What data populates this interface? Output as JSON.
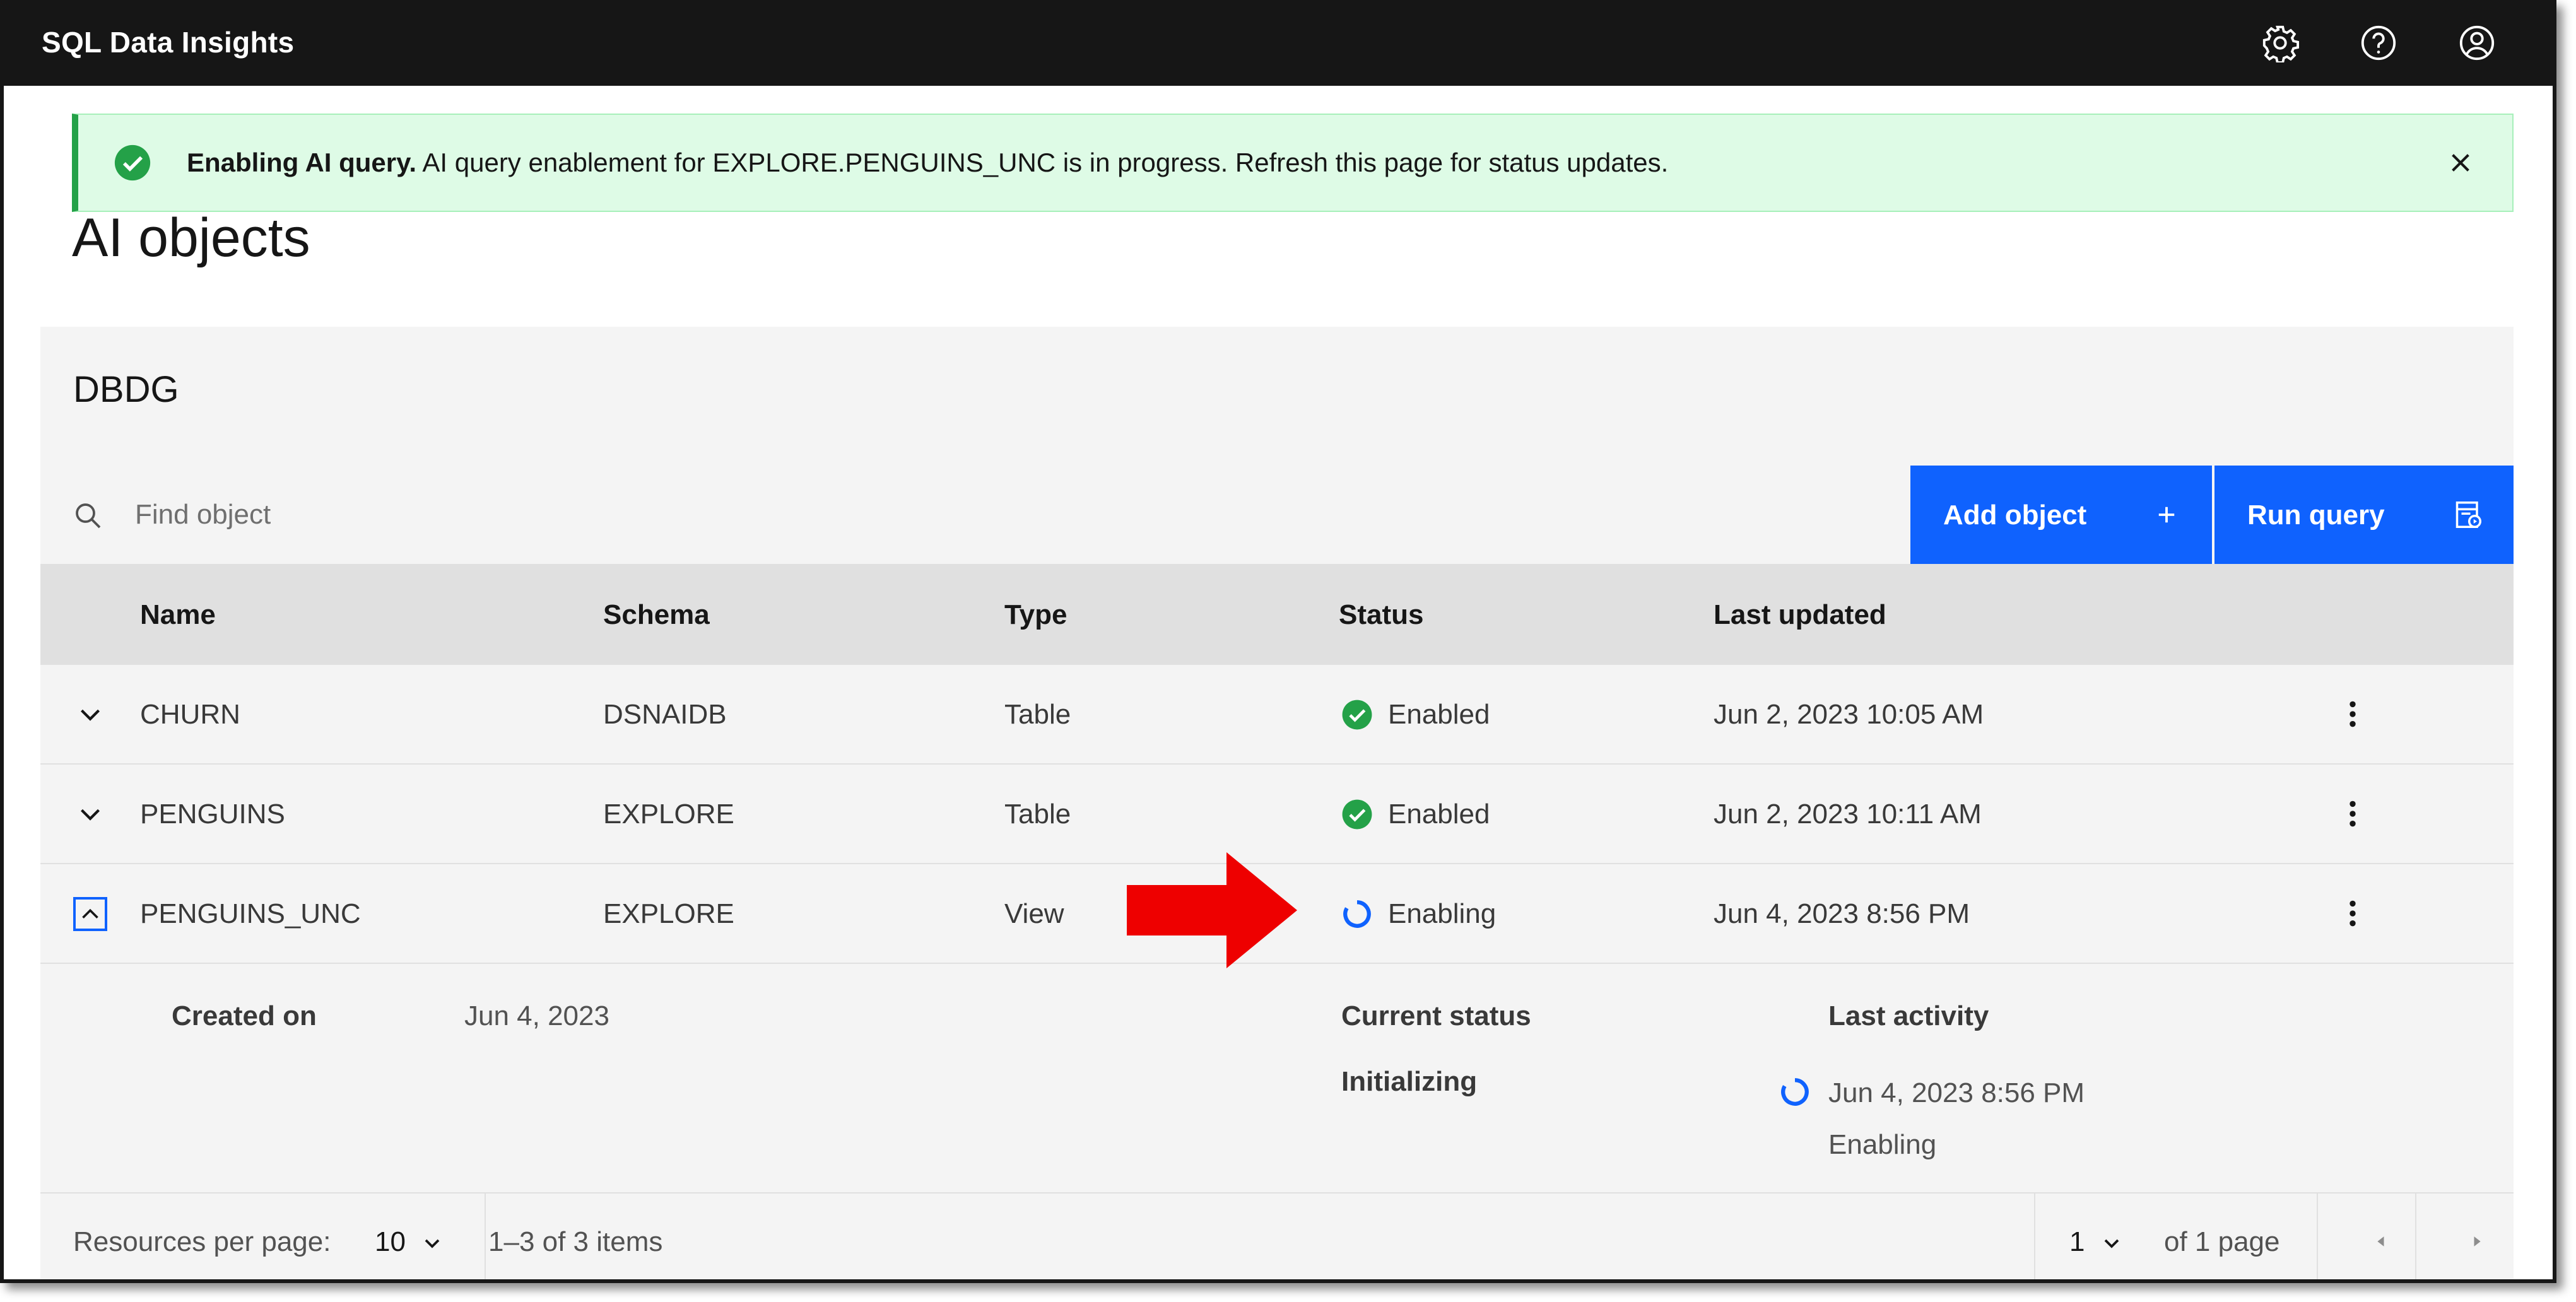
{
  "header": {
    "app_title": "SQL Data Insights",
    "icons": [
      "settings-icon",
      "help-icon",
      "user-avatar-icon"
    ]
  },
  "notification": {
    "kind": "success",
    "title": "Enabling AI query.",
    "message": " AI query enablement for EXPLORE.PENGUINS_UNC is in progress. Refresh this page for status updates."
  },
  "page": {
    "title": "AI objects"
  },
  "panel": {
    "database": "DBDG",
    "search_placeholder": "Find object",
    "add_button": "Add object",
    "run_button": "Run query"
  },
  "table": {
    "headers": {
      "name": "Name",
      "schema": "Schema",
      "type": "Type",
      "status": "Status",
      "updated": "Last updated"
    },
    "rows": [
      {
        "name": "CHURN",
        "schema": "DSNAIDB",
        "type": "Table",
        "status": "Enabled",
        "updated": "Jun 2, 2023 10:05 AM"
      },
      {
        "name": "PENGUINS",
        "schema": "EXPLORE",
        "type": "Table",
        "status": "Enabled",
        "updated": "Jun 2, 2023 10:11 AM"
      },
      {
        "name": "PENGUINS_UNC",
        "schema": "EXPLORE",
        "type": "View",
        "status": "Enabling",
        "updated": "Jun 4, 2023 8:56 PM"
      }
    ],
    "expanded": {
      "created_label": "Created on",
      "created_value": "Jun 4, 2023",
      "current_status_label": "Current status",
      "current_status_value": "Initializing",
      "activity_label": "Last activity",
      "activity_time": "Jun 4, 2023 8:56 PM",
      "activity_state": "Enabling"
    }
  },
  "pagination": {
    "per_page_label": "Resources per page:",
    "per_page_value": "10",
    "range": "1–3 of 3 items",
    "page_value": "1",
    "page_total": "of 1 page"
  },
  "colors": {
    "accent": "#0f62fe",
    "success": "#24a148",
    "notice_bg": "#defbe6",
    "header_bg": "#161616",
    "annotation_arrow": "#ee0000"
  }
}
